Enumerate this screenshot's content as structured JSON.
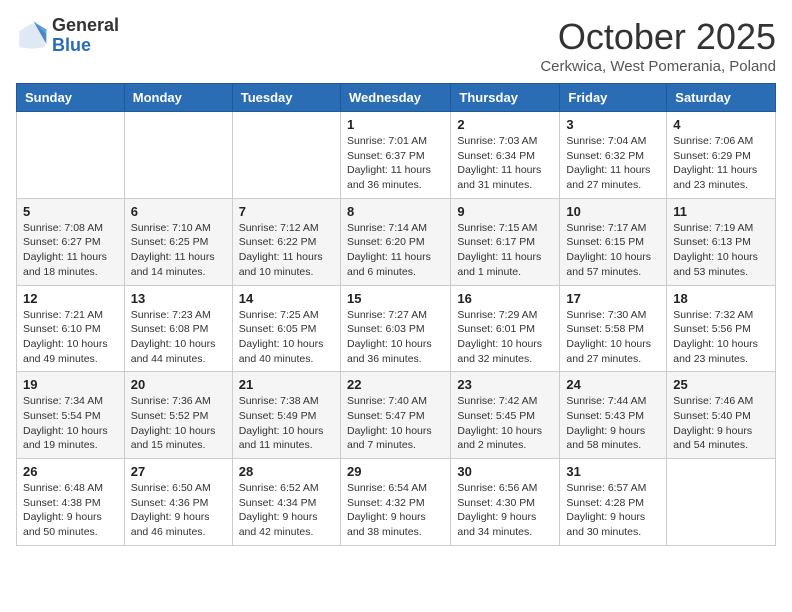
{
  "header": {
    "logo_general": "General",
    "logo_blue": "Blue",
    "month_title": "October 2025",
    "location": "Cerkwica, West Pomerania, Poland"
  },
  "days_of_week": [
    "Sunday",
    "Monday",
    "Tuesday",
    "Wednesday",
    "Thursday",
    "Friday",
    "Saturday"
  ],
  "weeks": [
    [
      {
        "day": "",
        "info": ""
      },
      {
        "day": "",
        "info": ""
      },
      {
        "day": "",
        "info": ""
      },
      {
        "day": "1",
        "info": "Sunrise: 7:01 AM\nSunset: 6:37 PM\nDaylight: 11 hours and 36 minutes."
      },
      {
        "day": "2",
        "info": "Sunrise: 7:03 AM\nSunset: 6:34 PM\nDaylight: 11 hours and 31 minutes."
      },
      {
        "day": "3",
        "info": "Sunrise: 7:04 AM\nSunset: 6:32 PM\nDaylight: 11 hours and 27 minutes."
      },
      {
        "day": "4",
        "info": "Sunrise: 7:06 AM\nSunset: 6:29 PM\nDaylight: 11 hours and 23 minutes."
      }
    ],
    [
      {
        "day": "5",
        "info": "Sunrise: 7:08 AM\nSunset: 6:27 PM\nDaylight: 11 hours and 18 minutes."
      },
      {
        "day": "6",
        "info": "Sunrise: 7:10 AM\nSunset: 6:25 PM\nDaylight: 11 hours and 14 minutes."
      },
      {
        "day": "7",
        "info": "Sunrise: 7:12 AM\nSunset: 6:22 PM\nDaylight: 11 hours and 10 minutes."
      },
      {
        "day": "8",
        "info": "Sunrise: 7:14 AM\nSunset: 6:20 PM\nDaylight: 11 hours and 6 minutes."
      },
      {
        "day": "9",
        "info": "Sunrise: 7:15 AM\nSunset: 6:17 PM\nDaylight: 11 hours and 1 minute."
      },
      {
        "day": "10",
        "info": "Sunrise: 7:17 AM\nSunset: 6:15 PM\nDaylight: 10 hours and 57 minutes."
      },
      {
        "day": "11",
        "info": "Sunrise: 7:19 AM\nSunset: 6:13 PM\nDaylight: 10 hours and 53 minutes."
      }
    ],
    [
      {
        "day": "12",
        "info": "Sunrise: 7:21 AM\nSunset: 6:10 PM\nDaylight: 10 hours and 49 minutes."
      },
      {
        "day": "13",
        "info": "Sunrise: 7:23 AM\nSunset: 6:08 PM\nDaylight: 10 hours and 44 minutes."
      },
      {
        "day": "14",
        "info": "Sunrise: 7:25 AM\nSunset: 6:05 PM\nDaylight: 10 hours and 40 minutes."
      },
      {
        "day": "15",
        "info": "Sunrise: 7:27 AM\nSunset: 6:03 PM\nDaylight: 10 hours and 36 minutes."
      },
      {
        "day": "16",
        "info": "Sunrise: 7:29 AM\nSunset: 6:01 PM\nDaylight: 10 hours and 32 minutes."
      },
      {
        "day": "17",
        "info": "Sunrise: 7:30 AM\nSunset: 5:58 PM\nDaylight: 10 hours and 27 minutes."
      },
      {
        "day": "18",
        "info": "Sunrise: 7:32 AM\nSunset: 5:56 PM\nDaylight: 10 hours and 23 minutes."
      }
    ],
    [
      {
        "day": "19",
        "info": "Sunrise: 7:34 AM\nSunset: 5:54 PM\nDaylight: 10 hours and 19 minutes."
      },
      {
        "day": "20",
        "info": "Sunrise: 7:36 AM\nSunset: 5:52 PM\nDaylight: 10 hours and 15 minutes."
      },
      {
        "day": "21",
        "info": "Sunrise: 7:38 AM\nSunset: 5:49 PM\nDaylight: 10 hours and 11 minutes."
      },
      {
        "day": "22",
        "info": "Sunrise: 7:40 AM\nSunset: 5:47 PM\nDaylight: 10 hours and 7 minutes."
      },
      {
        "day": "23",
        "info": "Sunrise: 7:42 AM\nSunset: 5:45 PM\nDaylight: 10 hours and 2 minutes."
      },
      {
        "day": "24",
        "info": "Sunrise: 7:44 AM\nSunset: 5:43 PM\nDaylight: 9 hours and 58 minutes."
      },
      {
        "day": "25",
        "info": "Sunrise: 7:46 AM\nSunset: 5:40 PM\nDaylight: 9 hours and 54 minutes."
      }
    ],
    [
      {
        "day": "26",
        "info": "Sunrise: 6:48 AM\nSunset: 4:38 PM\nDaylight: 9 hours and 50 minutes."
      },
      {
        "day": "27",
        "info": "Sunrise: 6:50 AM\nSunset: 4:36 PM\nDaylight: 9 hours and 46 minutes."
      },
      {
        "day": "28",
        "info": "Sunrise: 6:52 AM\nSunset: 4:34 PM\nDaylight: 9 hours and 42 minutes."
      },
      {
        "day": "29",
        "info": "Sunrise: 6:54 AM\nSunset: 4:32 PM\nDaylight: 9 hours and 38 minutes."
      },
      {
        "day": "30",
        "info": "Sunrise: 6:56 AM\nSunset: 4:30 PM\nDaylight: 9 hours and 34 minutes."
      },
      {
        "day": "31",
        "info": "Sunrise: 6:57 AM\nSunset: 4:28 PM\nDaylight: 9 hours and 30 minutes."
      },
      {
        "day": "",
        "info": ""
      }
    ]
  ]
}
